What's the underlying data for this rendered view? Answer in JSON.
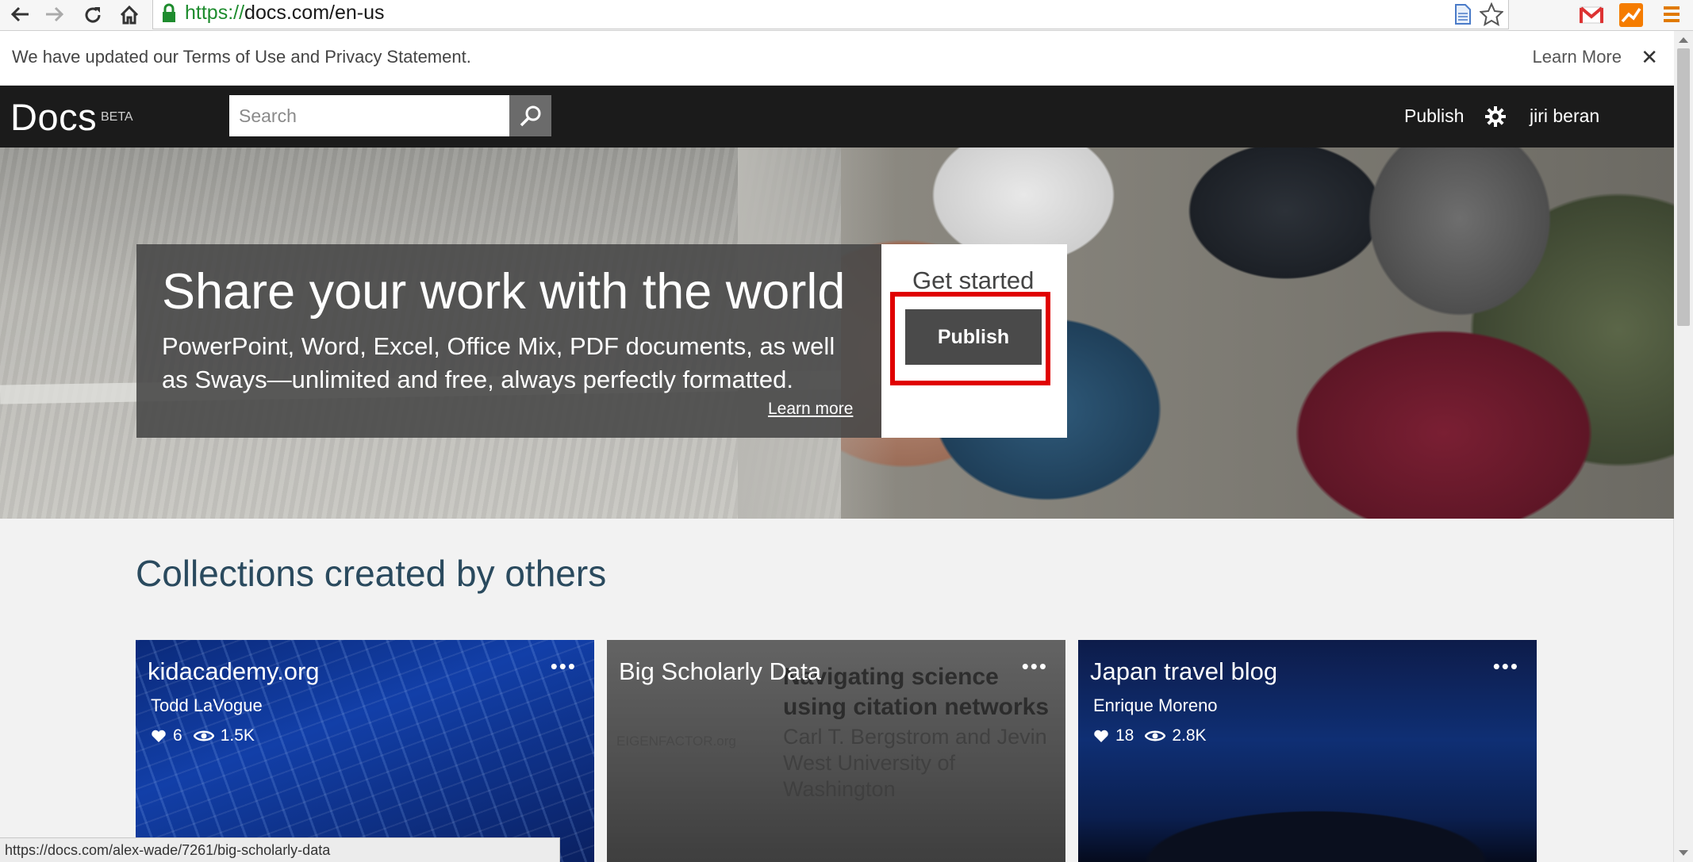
{
  "browser": {
    "url_scheme": "https://",
    "url_rest": "docs.com/en-us",
    "icons": [
      "back-icon",
      "forward-icon",
      "reload-icon",
      "home-icon",
      "lock-icon",
      "page-icon",
      "star-icon",
      "gmail-icon",
      "analytics-icon",
      "menu-icon"
    ]
  },
  "terms": {
    "message": "We have updated our Terms of Use and Privacy Statement.",
    "learn_more": "Learn More",
    "close": "✕"
  },
  "header": {
    "logo": "Docs",
    "beta": "BETA",
    "search_placeholder": "Search",
    "publish": "Publish",
    "user": "jiri beran"
  },
  "hero": {
    "title": "Share your work with the world",
    "description": "PowerPoint, Word, Excel, Office Mix, PDF documents, as well as Sways—unlimited and free, always perfectly formatted.",
    "learn_more": "Learn more",
    "get_started": "Get started",
    "publish_button": "Publish",
    "highlight_color": "#e00000"
  },
  "collections": {
    "heading": "Collections created by others",
    "cards": [
      {
        "title": "kidacademy.org",
        "author": "Todd LaVogue",
        "likes": "6",
        "views": "1.5K",
        "more": "•••"
      },
      {
        "title": "Big Scholarly Data",
        "more": "•••",
        "bg_title": "Navigating science using citation networks",
        "bg_authors": "Carl T. Bergstrom and Jevin West University of Washington",
        "bg_logo": "EIGENFACTOR.org"
      },
      {
        "title": "Japan travel blog",
        "author": "Enrique Moreno",
        "likes": "18",
        "views": "2.8K",
        "more": "•••"
      }
    ]
  },
  "status_bar": {
    "url": "https://docs.com/alex-wade/7261/big-scholarly-data"
  }
}
